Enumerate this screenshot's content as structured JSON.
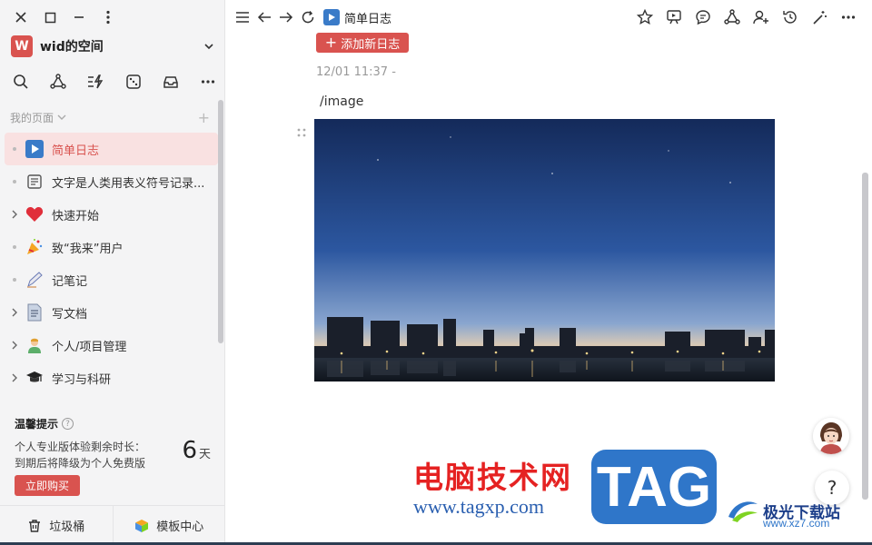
{
  "workspace": {
    "initial": "W",
    "name": "wid的空间"
  },
  "sidebar": {
    "section_title": "我的页面",
    "items": [
      {
        "label": "简单日志",
        "icon": "play-icon",
        "active": true,
        "expandable": false
      },
      {
        "label": "文字是人类用表义符号记录...",
        "icon": "document-icon",
        "active": false,
        "expandable": false
      },
      {
        "label": "快速开始",
        "icon": "heart-icon",
        "active": false,
        "expandable": true
      },
      {
        "label": "致“我来”用户",
        "icon": "party-icon",
        "active": false,
        "expandable": false
      },
      {
        "label": "记笔记",
        "icon": "pen-icon",
        "active": false,
        "expandable": false
      },
      {
        "label": "写文档",
        "icon": "file-icon",
        "active": false,
        "expandable": true
      },
      {
        "label": "个人/项目管理",
        "icon": "person-icon",
        "active": false,
        "expandable": true
      },
      {
        "label": "学习与科研",
        "icon": "graduation-cap-icon",
        "active": false,
        "expandable": true
      }
    ]
  },
  "tip": {
    "title": "温馨提示",
    "line1": "个人专业版体验剩余时长：",
    "line2": "到期后将降级为个人免费版",
    "days_value": "6",
    "days_unit": "天",
    "buy_label": "立即购买"
  },
  "bottom": {
    "trash_label": "垃圾桶",
    "template_label": "模板中心"
  },
  "header": {
    "breadcrumb": "简单日志"
  },
  "content": {
    "add_label": "添加新日志",
    "timestamp": "12/01 11:37 -",
    "command": "/image"
  },
  "help_label": "?",
  "watermark": {
    "cn": "电脑技术网",
    "url": "www.tagxp.com",
    "tag": "TAG",
    "jg_name": "极光下载站",
    "jg_url": "www.xz7.com"
  },
  "colors": {
    "accent": "#d9534f",
    "brand_blue": "#3a7bc8"
  }
}
